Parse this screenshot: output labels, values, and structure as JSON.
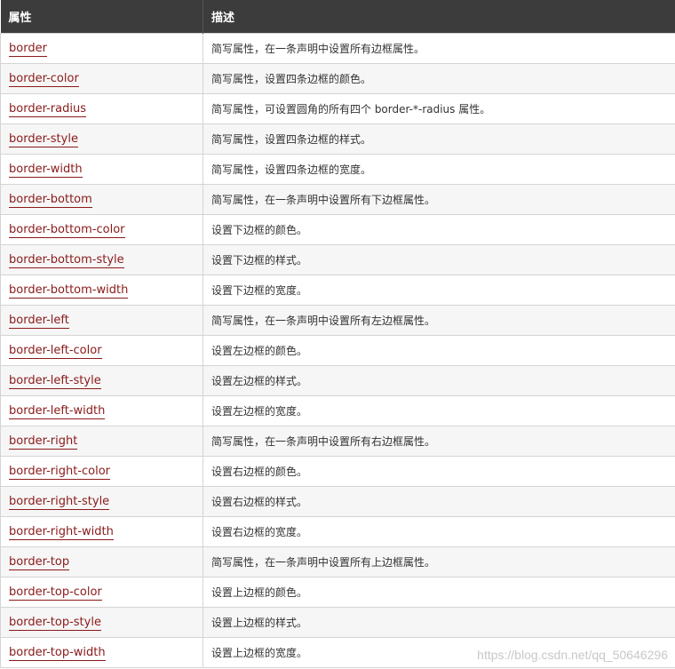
{
  "table": {
    "headers": {
      "property": "属性",
      "description": "描述"
    },
    "rows": [
      {
        "property": "border",
        "description": "简写属性，在一条声明中设置所有边框属性。"
      },
      {
        "property": "border-color",
        "description": "简写属性，设置四条边框的颜色。"
      },
      {
        "property": "border-radius",
        "description": "简写属性，可设置圆角的所有四个 border-*-radius 属性。"
      },
      {
        "property": "border-style",
        "description": "简写属性，设置四条边框的样式。"
      },
      {
        "property": "border-width",
        "description": "简写属性，设置四条边框的宽度。"
      },
      {
        "property": "border-bottom",
        "description": "简写属性，在一条声明中设置所有下边框属性。"
      },
      {
        "property": "border-bottom-color",
        "description": "设置下边框的颜色。"
      },
      {
        "property": "border-bottom-style",
        "description": "设置下边框的样式。"
      },
      {
        "property": "border-bottom-width",
        "description": "设置下边框的宽度。"
      },
      {
        "property": "border-left",
        "description": "简写属性，在一条声明中设置所有左边框属性。"
      },
      {
        "property": "border-left-color",
        "description": "设置左边框的颜色。"
      },
      {
        "property": "border-left-style",
        "description": "设置左边框的样式。"
      },
      {
        "property": "border-left-width",
        "description": "设置左边框的宽度。"
      },
      {
        "property": "border-right",
        "description": "简写属性，在一条声明中设置所有右边框属性。"
      },
      {
        "property": "border-right-color",
        "description": "设置右边框的颜色。"
      },
      {
        "property": "border-right-style",
        "description": "设置右边框的样式。"
      },
      {
        "property": "border-right-width",
        "description": "设置右边框的宽度。"
      },
      {
        "property": "border-top",
        "description": "简写属性，在一条声明中设置所有上边框属性。"
      },
      {
        "property": "border-top-color",
        "description": "设置上边框的颜色。"
      },
      {
        "property": "border-top-style",
        "description": "设置上边框的样式。"
      },
      {
        "property": "border-top-width",
        "description": "设置上边框的宽度。"
      }
    ]
  },
  "watermark": "https://blog.csdn.net/qq_50646296",
  "colors": {
    "header_bg": "#3c3c3c",
    "link": "#8a1a1a",
    "stripe": "#f6f6f6"
  }
}
